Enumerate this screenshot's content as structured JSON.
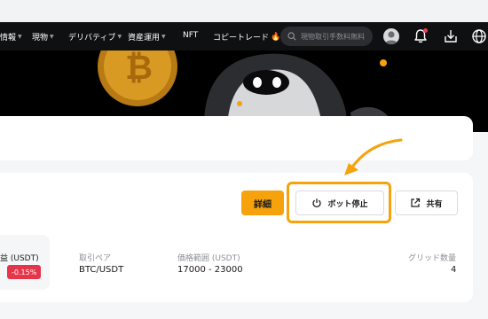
{
  "navbar": {
    "items": [
      {
        "label": "情報",
        "dropdown": true
      },
      {
        "label": "現物",
        "dropdown": true
      },
      {
        "label": "デリバティブ",
        "dropdown": true
      },
      {
        "label": "資産運用",
        "dropdown": true
      },
      {
        "label": "NFT",
        "dropdown": false
      },
      {
        "label": "コピートレード",
        "dropdown": false
      }
    ],
    "search_placeholder": "現物取引手数料無料",
    "icons": [
      "search-icon",
      "avatar",
      "bell-icon",
      "download-icon",
      "globe-icon"
    ]
  },
  "bot_card": {
    "detail_button": "詳細",
    "stop_button": "ボット停止",
    "share_button": "共有",
    "pnl_label": "益 (USDT)",
    "pnl_change": "-0.15%",
    "pair_label": "取引ペア",
    "pair_value": "BTC/USDT",
    "range_label": "価格範囲 (USDT)",
    "range_value": "17000 - 23000",
    "grid_label": "グリッド数量",
    "grid_value": "4"
  },
  "colors": {
    "accent": "#f5a20d",
    "negative": "#e5354a",
    "nav_bg": "#0f1012"
  }
}
